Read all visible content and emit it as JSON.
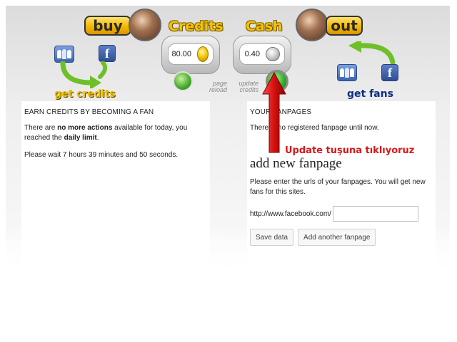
{
  "header": {
    "buy_label": "buy",
    "credits_label": "Credits",
    "cash_label": "Cash",
    "out_label": "out",
    "credits_value": "80.00",
    "cash_value": "0.40",
    "page_reload_label": "page reload",
    "update_credits_label": "update credits",
    "get_credits_label": "get credits",
    "get_fans_label": "get fans",
    "facebook_glyph": "f"
  },
  "left_panel": {
    "title": "EARN CREDITS BY BECOMING A FAN",
    "line1_pre": "There are ",
    "line1_bold": "no more actions",
    "line1_mid": " available for today, you reached the ",
    "line1_bold2": "daily limit",
    "line1_end": ".",
    "line2": "Please wait 7 hours 39 minutes and 50 seconds."
  },
  "right_panel": {
    "title": "YOUR FANPAGES",
    "info": "There is no registered fanpage until now.",
    "add_heading": "add new fanpage",
    "add_desc": "Please enter the urls of your fanpages. You will get new fans for this sites.",
    "url_prefix": "http://www.facebook.com/",
    "url_value": "",
    "save_label": "Save data",
    "add_another_label": "Add another fanpage"
  },
  "annotation": {
    "text": "Update tuşuna tıklıyoruz",
    "color": "#d81818"
  },
  "colors": {
    "gold": "#f5c400",
    "fb_blue": "#2f4f94",
    "green": "#4cb030"
  }
}
